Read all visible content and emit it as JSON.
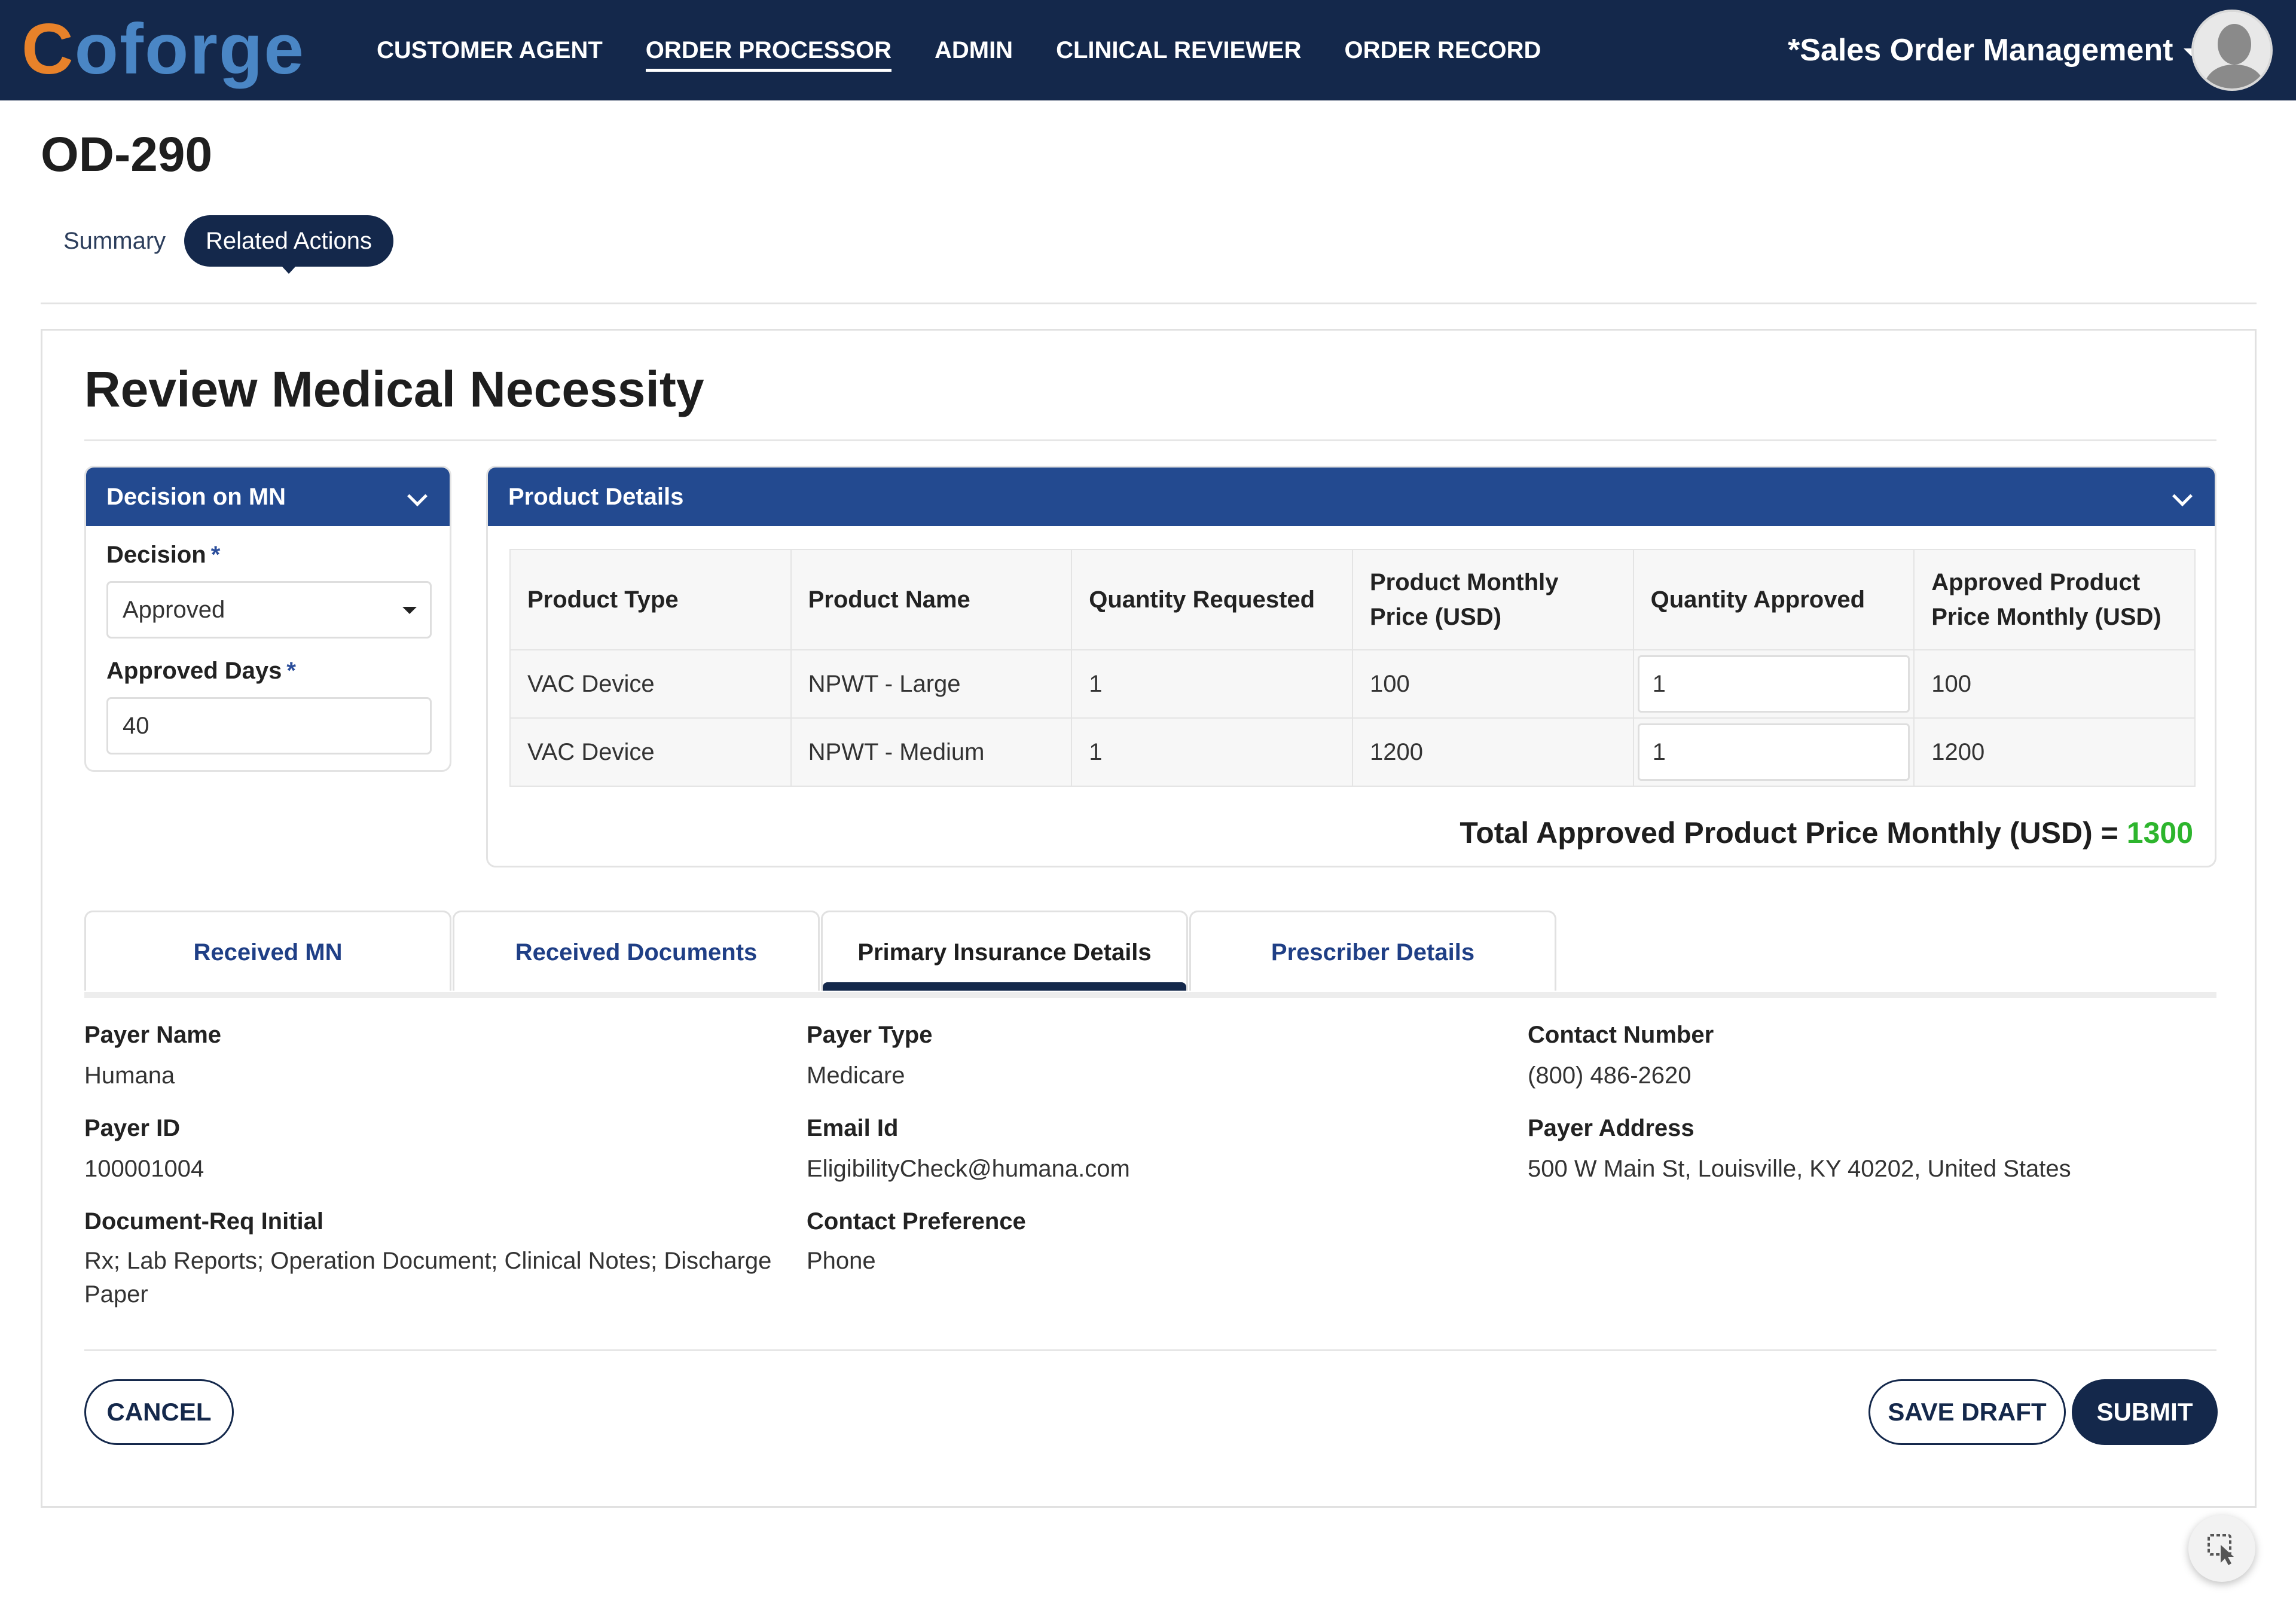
{
  "header": {
    "logo_c": "C",
    "logo_o": "o",
    "logo_rest": "forge",
    "nav": [
      {
        "label": "CUSTOMER AGENT",
        "active": false
      },
      {
        "label": "ORDER PROCESSOR",
        "active": true
      },
      {
        "label": "ADMIN",
        "active": false
      },
      {
        "label": "CLINICAL REVIEWER",
        "active": false
      },
      {
        "label": "ORDER RECORD",
        "active": false
      }
    ],
    "app_menu": "*Sales Order Management"
  },
  "page": {
    "title": "OD-290",
    "tabs": [
      {
        "label": "Summary",
        "active": false
      },
      {
        "label": "Related Actions",
        "active": true
      }
    ]
  },
  "form": {
    "title": "Review Medical Necessity",
    "decision_panel": {
      "header": "Decision on MN",
      "decision_label": "Decision",
      "decision_value": "Approved",
      "days_label": "Approved Days",
      "days_value": "40",
      "required_mark": "*"
    },
    "product_panel": {
      "header": "Product Details",
      "columns": [
        "Product Type",
        "Product Name",
        "Quantity Requested",
        "Product Monthly Price (USD)",
        "Quantity Approved",
        "Approved Product Price Monthly (USD)"
      ],
      "rows": [
        {
          "type": "VAC Device",
          "name": "NPWT - Large",
          "qty_requested": "1",
          "price": "100",
          "qty_approved": "1",
          "approved_price": "100"
        },
        {
          "type": "VAC Device",
          "name": "NPWT - Medium",
          "qty_requested": "1",
          "price": "1200",
          "qty_approved": "1",
          "approved_price": "1200"
        }
      ],
      "total_label": "Total Approved Product Price Monthly (USD) =",
      "total_value": "1300",
      "total_color": "#2db52d"
    },
    "detail_tabs": [
      {
        "label": "Received MN",
        "active": false
      },
      {
        "label": "Received Documents",
        "active": false
      },
      {
        "label": "Primary Insurance Details",
        "active": true
      },
      {
        "label": "Prescriber Details",
        "active": false
      }
    ],
    "insurance": {
      "payer_name_label": "Payer Name",
      "payer_name": "Humana",
      "payer_type_label": "Payer Type",
      "payer_type": "Medicare",
      "contact_number_label": "Contact Number",
      "contact_number": "(800) 486-2620",
      "payer_id_label": "Payer ID",
      "payer_id": "100001004",
      "email_label": "Email Id",
      "email": "EligibilityCheck@humana.com",
      "payer_address_label": "Payer Address",
      "payer_address": "500 W Main St, Louisville, KY 40202, United States",
      "doc_req_label": "Document-Req Initial",
      "doc_req": "Rx; Lab Reports; Operation Document; Clinical Notes; Discharge Paper",
      "contact_pref_label": "Contact Preference",
      "contact_pref": "Phone"
    },
    "buttons": {
      "cancel": "CANCEL",
      "save_draft": "SAVE DRAFT",
      "submit": "SUBMIT"
    }
  },
  "colors": {
    "header_bg": "#14284b",
    "panel_head": "#234a90",
    "accent_orange": "#e8822a",
    "accent_blue": "#4a86c5"
  }
}
